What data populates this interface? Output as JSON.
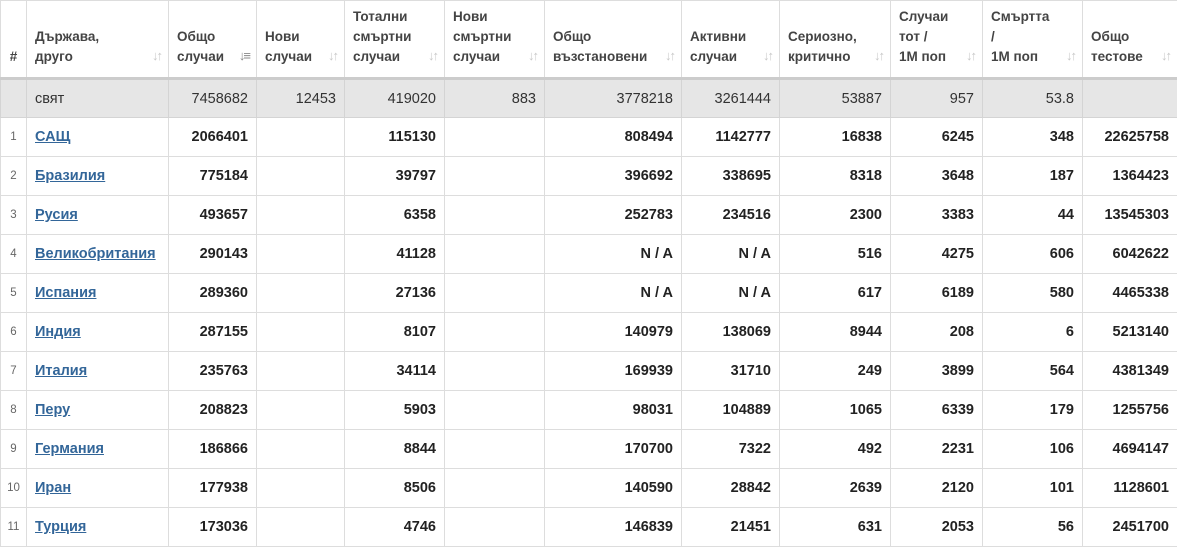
{
  "table": {
    "headers": [
      {
        "key": "idx",
        "lines": [
          "#"
        ]
      },
      {
        "key": "country",
        "lines": [
          "Държава,",
          "друго"
        ]
      },
      {
        "key": "total_cases",
        "lines": [
          "Общо",
          "случаи"
        ]
      },
      {
        "key": "new_cases",
        "lines": [
          "Нови",
          "случаи"
        ]
      },
      {
        "key": "total_deaths",
        "lines": [
          "Тотални",
          "смъртни",
          "случаи"
        ]
      },
      {
        "key": "new_deaths",
        "lines": [
          "Нови",
          "смъртни",
          "случаи"
        ]
      },
      {
        "key": "total_recovered",
        "lines": [
          "Общо",
          "възстановени"
        ]
      },
      {
        "key": "active_cases",
        "lines": [
          "Активни",
          "случаи"
        ]
      },
      {
        "key": "serious_critical",
        "lines": [
          "Сериозно,",
          "критично"
        ]
      },
      {
        "key": "cases_per_1m",
        "lines": [
          "Случаи",
          "тот /",
          "1М поп"
        ]
      },
      {
        "key": "deaths_per_1m",
        "lines": [
          "Смъртта",
          "/",
          "1М поп"
        ]
      },
      {
        "key": "total_tests",
        "lines": [
          "Общо",
          "тестове"
        ]
      }
    ],
    "world": {
      "idx": "",
      "country": "свят",
      "total_cases": "7458682",
      "new_cases": "12453",
      "total_deaths": "419020",
      "new_deaths": "883",
      "total_recovered": "3778218",
      "active_cases": "3261444",
      "serious_critical": "53887",
      "cases_per_1m": "957",
      "deaths_per_1m": "53.8",
      "total_tests": ""
    },
    "rows": [
      {
        "idx": "1",
        "country": "САЩ",
        "total_cases": "2066401",
        "new_cases": "",
        "total_deaths": "115130",
        "new_deaths": "",
        "total_recovered": "808494",
        "active_cases": "1142777",
        "serious_critical": "16838",
        "cases_per_1m": "6245",
        "deaths_per_1m": "348",
        "total_tests": "22625758"
      },
      {
        "idx": "2",
        "country": "Бразилия",
        "total_cases": "775184",
        "new_cases": "",
        "total_deaths": "39797",
        "new_deaths": "",
        "total_recovered": "396692",
        "active_cases": "338695",
        "serious_critical": "8318",
        "cases_per_1m": "3648",
        "deaths_per_1m": "187",
        "total_tests": "1364423"
      },
      {
        "idx": "3",
        "country": "Русия",
        "total_cases": "493657",
        "new_cases": "",
        "total_deaths": "6358",
        "new_deaths": "",
        "total_recovered": "252783",
        "active_cases": "234516",
        "serious_critical": "2300",
        "cases_per_1m": "3383",
        "deaths_per_1m": "44",
        "total_tests": "13545303"
      },
      {
        "idx": "4",
        "country": "Великобритания",
        "total_cases": "290143",
        "new_cases": "",
        "total_deaths": "41128",
        "new_deaths": "",
        "total_recovered": "N / A",
        "active_cases": "N / A",
        "serious_critical": "516",
        "cases_per_1m": "4275",
        "deaths_per_1m": "606",
        "total_tests": "6042622"
      },
      {
        "idx": "5",
        "country": "Испания",
        "total_cases": "289360",
        "new_cases": "",
        "total_deaths": "27136",
        "new_deaths": "",
        "total_recovered": "N / A",
        "active_cases": "N / A",
        "serious_critical": "617",
        "cases_per_1m": "6189",
        "deaths_per_1m": "580",
        "total_tests": "4465338"
      },
      {
        "idx": "6",
        "country": "Индия",
        "total_cases": "287155",
        "new_cases": "",
        "total_deaths": "8107",
        "new_deaths": "",
        "total_recovered": "140979",
        "active_cases": "138069",
        "serious_critical": "8944",
        "cases_per_1m": "208",
        "deaths_per_1m": "6",
        "total_tests": "5213140"
      },
      {
        "idx": "7",
        "country": "Италия",
        "total_cases": "235763",
        "new_cases": "",
        "total_deaths": "34114",
        "new_deaths": "",
        "total_recovered": "169939",
        "active_cases": "31710",
        "serious_critical": "249",
        "cases_per_1m": "3899",
        "deaths_per_1m": "564",
        "total_tests": "4381349"
      },
      {
        "idx": "8",
        "country": "Перу",
        "total_cases": "208823",
        "new_cases": "",
        "total_deaths": "5903",
        "new_deaths": "",
        "total_recovered": "98031",
        "active_cases": "104889",
        "serious_critical": "1065",
        "cases_per_1m": "6339",
        "deaths_per_1m": "179",
        "total_tests": "1255756"
      },
      {
        "idx": "9",
        "country": "Германия",
        "total_cases": "186866",
        "new_cases": "",
        "total_deaths": "8844",
        "new_deaths": "",
        "total_recovered": "170700",
        "active_cases": "7322",
        "serious_critical": "492",
        "cases_per_1m": "2231",
        "deaths_per_1m": "106",
        "total_tests": "4694147"
      },
      {
        "idx": "10",
        "country": "Иран",
        "total_cases": "177938",
        "new_cases": "",
        "total_deaths": "8506",
        "new_deaths": "",
        "total_recovered": "140590",
        "active_cases": "28842",
        "serious_critical": "2639",
        "cases_per_1m": "2120",
        "deaths_per_1m": "101",
        "total_tests": "1128601"
      },
      {
        "idx": "11",
        "country": "Турция",
        "total_cases": "173036",
        "new_cases": "",
        "total_deaths": "4746",
        "new_deaths": "",
        "total_recovered": "146839",
        "active_cases": "21451",
        "serious_critical": "631",
        "cases_per_1m": "2053",
        "deaths_per_1m": "56",
        "total_tests": "2451700"
      }
    ]
  },
  "icons": {
    "sort": "sort-arrows-icon",
    "sort_active": "sort-descending-icon"
  },
  "colors": {
    "link": "#336699",
    "world_row_bg": "#e6e6e6",
    "border": "#dddddd"
  }
}
